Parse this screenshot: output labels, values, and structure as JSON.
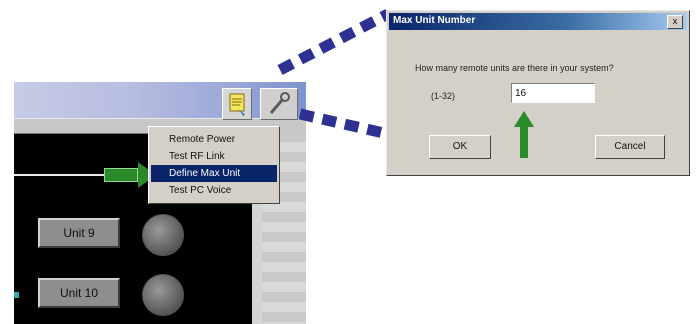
{
  "app": {
    "units": [
      {
        "label": "Unit 9"
      },
      {
        "label": "Unit 10"
      }
    ],
    "menu": {
      "items": [
        {
          "label": "Remote Power",
          "selected": false
        },
        {
          "label": "Test RF Link",
          "selected": false
        },
        {
          "label": "Define Max Unit",
          "selected": true
        },
        {
          "label": "Test PC Voice",
          "selected": false
        }
      ]
    }
  },
  "dialog": {
    "title": "Max Unit Number",
    "close_label": "x",
    "question": "How many remote units are there in your system?",
    "range_label": "(1-32)",
    "input_value": "16",
    "ok_label": "OK",
    "cancel_label": "Cancel"
  },
  "colors": {
    "connector": "#2e3192",
    "arrow": "#2a8a2a",
    "menu_selection": "#0a246a"
  }
}
